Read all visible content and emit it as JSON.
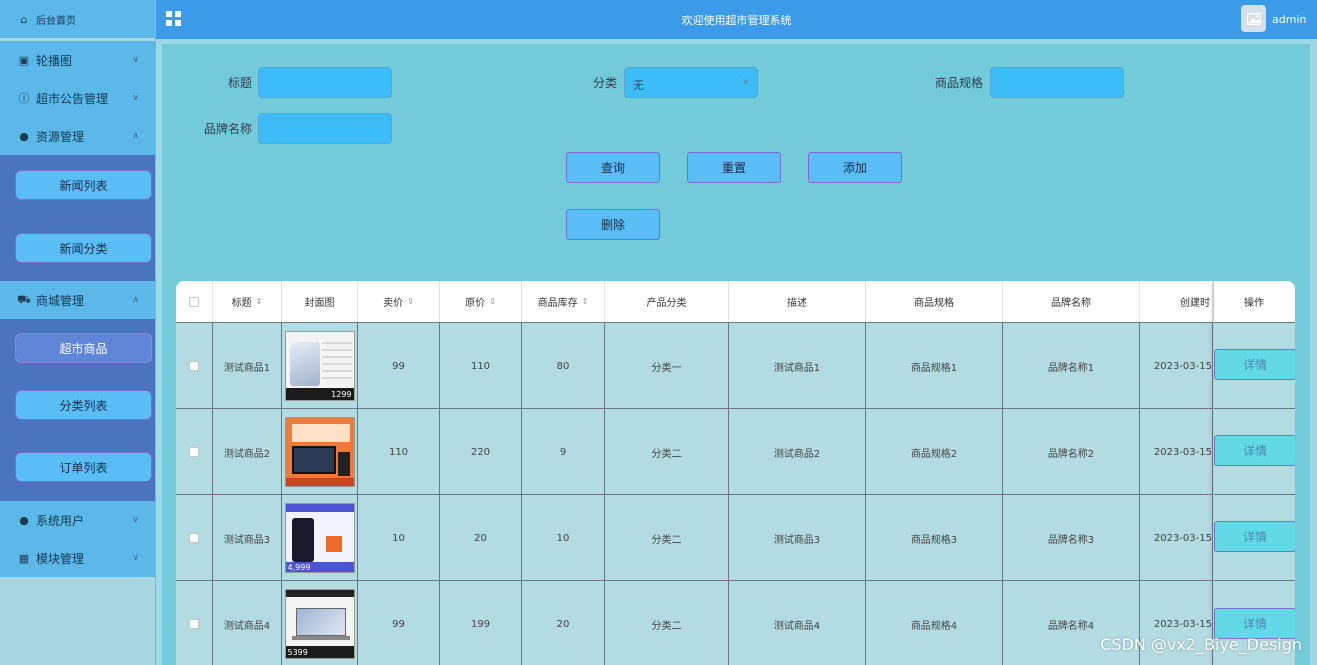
{
  "header": {
    "title": "欢迎使用超市管理系统",
    "user": "admin"
  },
  "sidebar": {
    "home": "后台首页",
    "carousel": "轮播图",
    "notice": "超市公告管理",
    "resource": "资源管理",
    "resource_items": [
      "新闻列表",
      "新闻分类"
    ],
    "mall": "商城管理",
    "mall_items": [
      "超市商品",
      "分类列表",
      "订单列表"
    ],
    "users": "系统用户",
    "modules": "模块管理"
  },
  "search": {
    "title_label": "标题",
    "category_label": "分类",
    "category_value": "无",
    "spec_label": "商品规格",
    "brand_label": "品牌名称",
    "query": "查询",
    "reset": "重置",
    "add": "添加",
    "delete": "删除"
  },
  "table": {
    "columns": [
      "标题",
      "封面图",
      "卖价",
      "原价",
      "商品库存",
      "产品分类",
      "描述",
      "商品规格",
      "品牌名称",
      "创建时",
      "操作"
    ],
    "rows": [
      {
        "title": "测试商品1",
        "price": "99",
        "original": "110",
        "stock": "80",
        "category": "分类一",
        "desc": "测试商品1",
        "spec": "商品规格1",
        "brand": "品牌名称1",
        "created": "2023-03-15",
        "cover_price": "1299"
      },
      {
        "title": "测试商品2",
        "price": "110",
        "original": "220",
        "stock": "9",
        "category": "分类二",
        "desc": "测试商品2",
        "spec": "商品规格2",
        "brand": "品牌名称2",
        "created": "2023-03-15",
        "cover_price": ""
      },
      {
        "title": "测试商品3",
        "price": "10",
        "original": "20",
        "stock": "10",
        "category": "分类二",
        "desc": "测试商品3",
        "spec": "商品规格3",
        "brand": "品牌名称3",
        "created": "2023-03-15",
        "cover_price": "4,999"
      },
      {
        "title": "测试商品4",
        "price": "99",
        "original": "199",
        "stock": "20",
        "category": "分类二",
        "desc": "测试商品4",
        "spec": "商品规格4",
        "brand": "品牌名称4",
        "created": "2023-03-15",
        "cover_price": "5399"
      }
    ],
    "detail": "详情"
  },
  "watermark": "CSDN @vx2_Biye_Design"
}
